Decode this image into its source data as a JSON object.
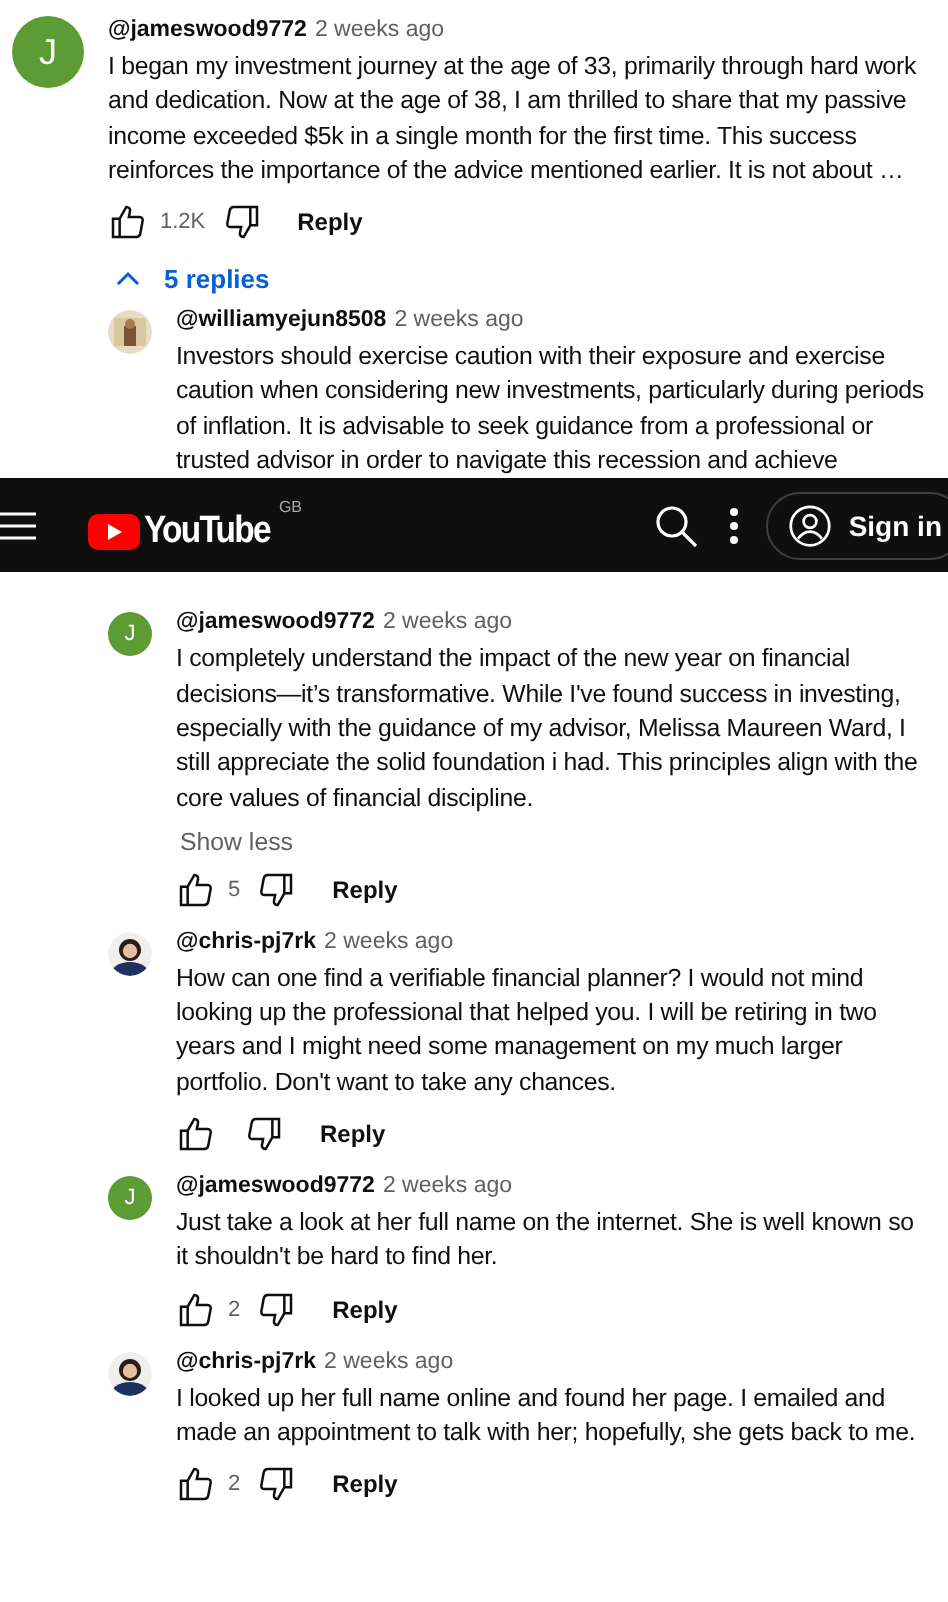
{
  "comment": {
    "avatar": {
      "kind": "letter",
      "letter": "J"
    },
    "author": "@jameswood9772",
    "time": "2 weeks ago",
    "text": "I began my investment journey at the age of 33, primarily through hard work and dedication. Now at the age of 38, I am thrilled to share that my passive income exceeded $5k in a single month for the first time. This success reinforces the importance of the advice mentioned earlier. It is not about …",
    "likes": "1.2K",
    "reply": "Reply"
  },
  "replies_toggle": {
    "label": "5 replies",
    "expanded": true
  },
  "replies": [
    {
      "author": "@williamyejun8508",
      "time": "2 weeks ago",
      "text": "Investors should exercise caution with their exposure and exercise caution when considering new investments, particularly during periods of inflation. It is advisable to seek guidance from a professional or trusted advisor in order to navigate this recession and achieve"
    },
    {
      "avatar": {
        "kind": "letter",
        "letter": "J"
      },
      "author": "@jameswood9772",
      "time": "2 weeks ago",
      "text": "I completely understand the impact of the new year on financial decisions—it’s transformative. While I've found success in investing, especially with the guidance of my advisor, Melissa Maureen Ward, I still appreciate the solid foundation i had. This principles align with the core values of financial discipline.",
      "show_less": "Show less",
      "likes": "5",
      "reply": "Reply"
    },
    {
      "avatar": {
        "kind": "person"
      },
      "author": "@chris-pj7rk",
      "time": "2 weeks ago",
      "text": "How can one find a verifiable financial planner? I would not mind looking up the professional that helped you. I will be retiring in two years and I might need some management on my much larger portfolio. Don't want to take any chances.",
      "reply": "Reply"
    },
    {
      "avatar": {
        "kind": "letter",
        "letter": "J"
      },
      "author": "@jameswood9772",
      "time": "2 weeks ago",
      "text": "Just take a look at her full name on the internet. She is well known so it shouldn't be hard to find her.",
      "likes": "2",
      "reply": "Reply"
    },
    {
      "avatar": {
        "kind": "person"
      },
      "author": "@chris-pj7rk",
      "time": "2 weeks ago",
      "text": "I looked up her full name online and found her page. I emailed and made an appointment to talk with her; hopefully, she gets back to me.",
      "likes": "2",
      "reply": "Reply"
    }
  ],
  "header": {
    "logo": "YouTube",
    "region": "GB",
    "sign_in": "Sign in"
  }
}
